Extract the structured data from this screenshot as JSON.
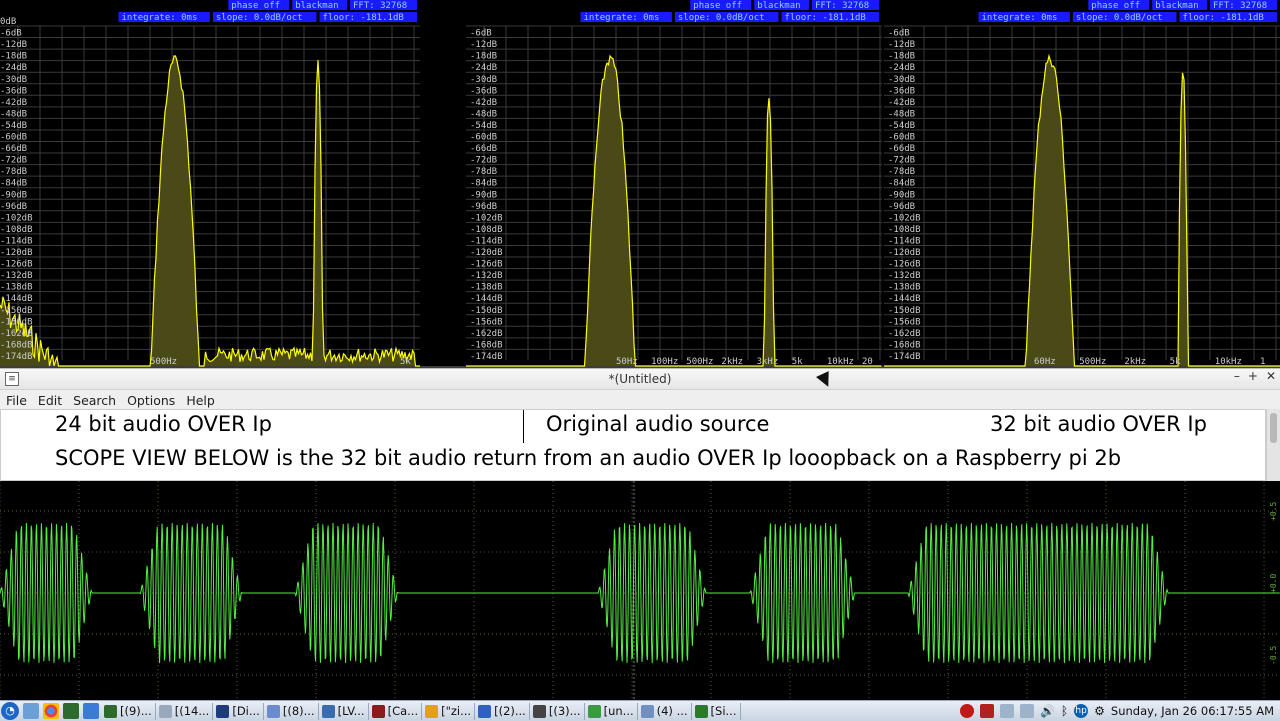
{
  "analyzers": [
    {
      "panel": "left",
      "readouts": [
        {
          "text": "phase off"
        },
        {
          "text": "blackman"
        },
        {
          "text": "FFT: 32768"
        }
      ],
      "readouts_row2": [
        {
          "text": "integrate: 0ms"
        },
        {
          "text": "slope: 0.0dB/oct"
        },
        {
          "text": "floor: -181.1dB"
        }
      ],
      "db_labels": [
        "0dB",
        "-6dB",
        "-12dB",
        "-18dB",
        "-24dB",
        "-30dB",
        "-36dB",
        "-42dB",
        "-48dB",
        "-54dB",
        "-60dB",
        "-66dB",
        "-72dB",
        "-78dB",
        "-84dB",
        "-90dB",
        "-96dB",
        "-102dB",
        "-108dB",
        "-114dB",
        "-120dB",
        "-126dB",
        "-132dB",
        "-138dB",
        "-144dB",
        "-150dB",
        "-156dB",
        "-162dB",
        "-168dB",
        "-174dB"
      ],
      "freq_labels": [
        "500Hz",
        "5k"
      ]
    },
    {
      "panel": "center",
      "readouts": [
        {
          "text": "phase off"
        },
        {
          "text": "blackman"
        },
        {
          "text": "FFT: 32768"
        }
      ],
      "readouts_row2": [
        {
          "text": "integrate: 0ms"
        },
        {
          "text": "slope: 0.0dB/oct"
        },
        {
          "text": "floor: -181.1dB"
        }
      ],
      "db_labels": [
        "-6dB",
        "-12dB",
        "-18dB",
        "-24dB",
        "-30dB",
        "-36dB",
        "-42dB",
        "-48dB",
        "-54dB",
        "-60dB",
        "-66dB",
        "-72dB",
        "-78dB",
        "-84dB",
        "-90dB",
        "-96dB",
        "-102dB",
        "-108dB",
        "-114dB",
        "-120dB",
        "-126dB",
        "-132dB",
        "-138dB",
        "-144dB",
        "-150dB",
        "-156dB",
        "-162dB",
        "-168dB",
        "-174dB"
      ],
      "freq_labels": [
        "50Hz",
        "100Hz",
        "500Hz",
        "2kHz",
        "3kHz",
        "5k",
        "10kHz",
        "20"
      ]
    },
    {
      "panel": "right",
      "readouts": [
        {
          "text": "phase off"
        },
        {
          "text": "blackman"
        },
        {
          "text": "FFT: 32768"
        }
      ],
      "readouts_row2": [
        {
          "text": "integrate: 0ms"
        },
        {
          "text": "slope: 0.0dB/oct"
        },
        {
          "text": "floor: -181.1dB"
        }
      ],
      "db_labels": [
        "-6dB",
        "-12dB",
        "-18dB",
        "-24dB",
        "-30dB",
        "-36dB",
        "-42dB",
        "-48dB",
        "-54dB",
        "-60dB",
        "-66dB",
        "-72dB",
        "-78dB",
        "-84dB",
        "-90dB",
        "-96dB",
        "-102dB",
        "-108dB",
        "-114dB",
        "-120dB",
        "-126dB",
        "-132dB",
        "-138dB",
        "-144dB",
        "-150dB",
        "-156dB",
        "-162dB",
        "-168dB",
        "-174dB"
      ],
      "freq_labels": [
        "60Hz",
        "500Hz",
        "2kHz",
        "5k",
        "10kHz",
        "1"
      ]
    }
  ],
  "colors": {
    "spectrum": "#ffff00",
    "spectrum_fill": "#4a4a18",
    "readout_bg": "#1a1aff",
    "readout_text": "#8fd0ff",
    "grid": "#3a3a3a",
    "scope_wave": "#55ee44",
    "scope_grid": "#5a5a30"
  },
  "editor": {
    "title": "*(Untitled)",
    "app_icon": "text-editor-icon",
    "controls": {
      "minimize": "–",
      "maximize": "+",
      "close": "✕"
    },
    "menu": [
      "File",
      "Edit",
      "Search",
      "Options",
      "Help"
    ],
    "line1": {
      "left": "24 bit audio OVER Ip",
      "center": "Original audio source",
      "right": "32 bit audio OVER Ip"
    },
    "line2": "SCOPE VIEW BELOW is the 32 bit audio return from an audio OVER Ip looopback on a Raspberry pi 2b"
  },
  "scope": {
    "side_labels": [
      "+0.5",
      "+0.0",
      "-0.5"
    ]
  },
  "taskbar": {
    "start_icon": "start-menu-icon",
    "tasks": [
      {
        "label": "[(9)...",
        "icon": "terminal-icon"
      },
      {
        "label": "[(14...",
        "icon": "editor-icon"
      },
      {
        "label": "[Di...",
        "icon": "monitor-icon"
      },
      {
        "label": "[(8)...",
        "icon": "window-icon"
      },
      {
        "label": "[LV...",
        "icon": "window-icon"
      },
      {
        "label": "[Ca...",
        "icon": "app-icon"
      },
      {
        "label": "[\"zi...",
        "icon": "chrome-icon"
      },
      {
        "label": "[(2)...",
        "icon": "v2-icon"
      },
      {
        "label": "[(3)...",
        "icon": "terminal-icon"
      },
      {
        "label": "[un...",
        "icon": "app-icon"
      },
      {
        "label": "(4) ...",
        "icon": "window-icon"
      },
      {
        "label": "[Si...",
        "icon": "globe-icon"
      }
    ],
    "clock": "Sunday, Jan 26 06:17:55 AM"
  }
}
